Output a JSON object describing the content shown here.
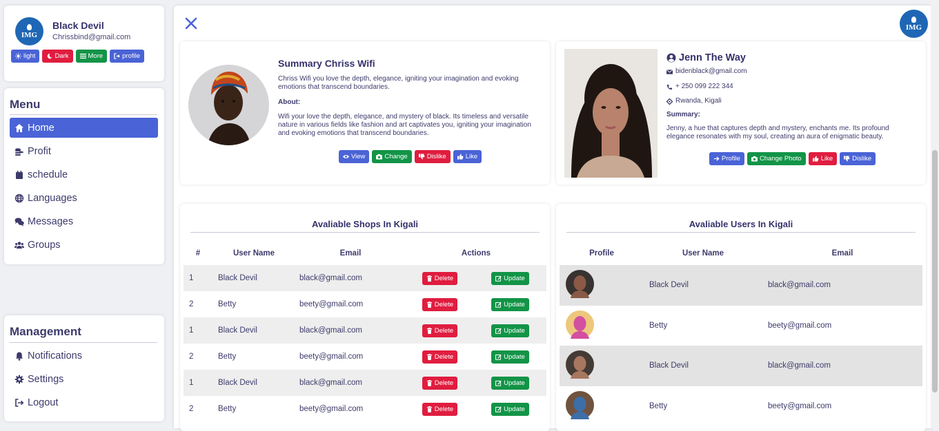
{
  "profile": {
    "logo_text": "IMG",
    "name": "Black Devil",
    "email": "Chrissbind@gmail.com",
    "buttons": [
      {
        "label": "light",
        "icon": "sun-icon",
        "color": "#4a63d6"
      },
      {
        "label": "Dark",
        "icon": "moon-icon",
        "color": "#e01d3f"
      },
      {
        "label": "More",
        "icon": "list-icon",
        "color": "#129447"
      },
      {
        "label": "profile",
        "icon": "sign-in-icon",
        "color": "#4a63d6"
      }
    ]
  },
  "menu": {
    "title": "Menu",
    "items": [
      {
        "label": "Home",
        "icon": "home-icon",
        "active": true
      },
      {
        "label": "Profit",
        "icon": "coins-icon"
      },
      {
        "label": "schedule",
        "icon": "calendar-icon"
      },
      {
        "label": "Languages",
        "icon": "globe-icon"
      },
      {
        "label": "Messages",
        "icon": "comments-icon"
      },
      {
        "label": "Groups",
        "icon": "users-icon"
      }
    ]
  },
  "management": {
    "title": "Management",
    "items": [
      {
        "label": "Notifications",
        "icon": "bell-icon"
      },
      {
        "label": "Settings",
        "icon": "gear-icon"
      },
      {
        "label": "Logout",
        "icon": "sign-out-icon"
      }
    ]
  },
  "header": {
    "logo_text": "IMG"
  },
  "summary": {
    "title": "Summary Chriss Wifi",
    "text": "Chriss Wifi you love the depth, elegance, igniting your imagination and evoking emotions that transcend boundaries.",
    "about_label": "About:",
    "about_text": "Wifi your love the depth, elegance, and mystery of black. Its timeless and versatile nature in various fields like fashion and art captivates you, igniting your imagination and evoking emotions that transcend boundaries.",
    "buttons": [
      {
        "label": "View",
        "icon": "eye-icon",
        "color": "#4a63d6"
      },
      {
        "label": "Change",
        "icon": "camera-icon",
        "color": "#129447"
      },
      {
        "label": "Dislike",
        "icon": "thumbs-down-icon",
        "color": "#e01d3f"
      },
      {
        "label": "Like",
        "icon": "thumbs-up-icon",
        "color": "#4a63d6"
      }
    ]
  },
  "person": {
    "name": "Jenn The Way",
    "email": "bidenblack@gmail.com",
    "phone": "+ 250 099 222 344",
    "location": "Rwanda, Kigali",
    "summary_label": "Summary:",
    "summary_text": "Jenny, a hue that captures depth and mystery, enchants me. Its profound elegance resonates with my soul, creating an aura of enigmatic beauty.",
    "buttons": [
      {
        "label": "Profile",
        "icon": "arrow-right-icon",
        "color": "#4a63d6"
      },
      {
        "label": "Change Photo",
        "icon": "camera-icon",
        "color": "#129447"
      },
      {
        "label": "Like",
        "icon": "thumbs-up-icon",
        "color": "#e01d3f"
      },
      {
        "label": "Dislike",
        "icon": "thumbs-down-icon",
        "color": "#4a63d6"
      }
    ]
  },
  "shops": {
    "title": "Avaliable Shops In Kigali",
    "columns": [
      "#",
      "User Name",
      "Email",
      "Actions"
    ],
    "delete_label": "Delete",
    "update_label": "Update",
    "rows": [
      {
        "num": "1",
        "name": "Black Devil",
        "email": "black@gmail.com"
      },
      {
        "num": "2",
        "name": "Betty",
        "email": "beety@gmail.com"
      },
      {
        "num": "1",
        "name": "Black Devil",
        "email": "black@gmail.com"
      },
      {
        "num": "2",
        "name": "Betty",
        "email": "beety@gmail.com"
      },
      {
        "num": "1",
        "name": "Black Devil",
        "email": "black@gmail.com"
      },
      {
        "num": "2",
        "name": "Betty",
        "email": "beety@gmail.com"
      }
    ]
  },
  "users": {
    "title": "Avaliable Users In Kigali",
    "columns": [
      "Profile",
      "User Name",
      "Email"
    ],
    "rows": [
      {
        "name": "Black Devil",
        "email": "black@gmail.com"
      },
      {
        "name": "Betty",
        "email": "beety@gmail.com"
      },
      {
        "name": "Black Devil",
        "email": "black@gmail.com"
      },
      {
        "name": "Betty",
        "email": "beety@gmail.com"
      }
    ]
  }
}
